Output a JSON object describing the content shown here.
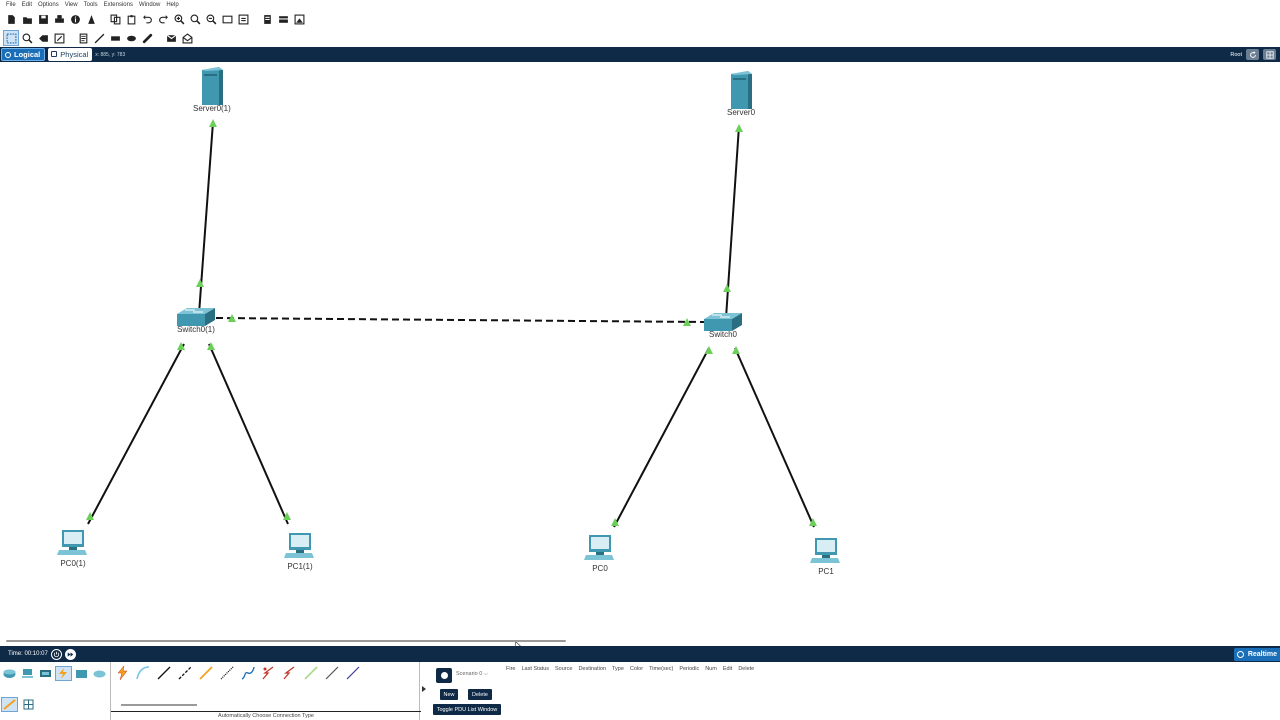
{
  "menu": [
    "File",
    "Edit",
    "Options",
    "View",
    "Tools",
    "Extensions",
    "Window",
    "Help"
  ],
  "toolbar1": [
    "new-icon",
    "open-icon",
    "save-icon",
    "print-icon",
    "info-icon",
    "wizard-icon",
    "copy-icon",
    "paste-icon",
    "undo-icon",
    "redo-icon",
    "zoom-in-icon",
    "zoom-reset-icon",
    "zoom-out-icon",
    "drawing-palette-icon",
    "custom-device-icon",
    "view-icon",
    "cluster-icon",
    "screenshot-icon"
  ],
  "toolbar2": [
    "select-icon",
    "inspect-icon",
    "delete-icon",
    "resize-icon",
    "note-icon",
    "line-icon",
    "rectangle-icon",
    "ellipse-icon",
    "freeform-icon",
    "simple-pdu-icon",
    "complex-pdu-icon"
  ],
  "view": {
    "logical_label": "Logical",
    "physical_label": "Physical",
    "coords": "x: 885, y: 783",
    "root_label": "Root"
  },
  "devices": {
    "server_left": "Server0(1)",
    "server_right": "Server0",
    "switch_left": "Switch0(1)",
    "switch_right": "Switch0",
    "pc0_left": "PC0(1)",
    "pc1_left": "PC1(1)",
    "pc0_right": "PC0",
    "pc1_right": "PC1"
  },
  "timebar": {
    "time": "Time: 00:10:07",
    "realtime_label": "Realtime"
  },
  "cables": {
    "caption": "Automatically Choose Connection Type"
  },
  "scenario": {
    "select_value": "Scenario 0",
    "new_label": "New",
    "delete_label": "Delete",
    "toggle_label": "Toggle PDU List Window"
  },
  "pdu_columns": [
    "Fire",
    "Last Status",
    "Source",
    "Destination",
    "Type",
    "Color",
    "Time(sec)",
    "Periodic",
    "Num",
    "Edit",
    "Delete"
  ],
  "colors": {
    "dark_bar": "#0f2a46",
    "accent_blue": "#1b6fb8",
    "device_teal": "#3f98b0",
    "link_light": "#6ccf5a"
  }
}
